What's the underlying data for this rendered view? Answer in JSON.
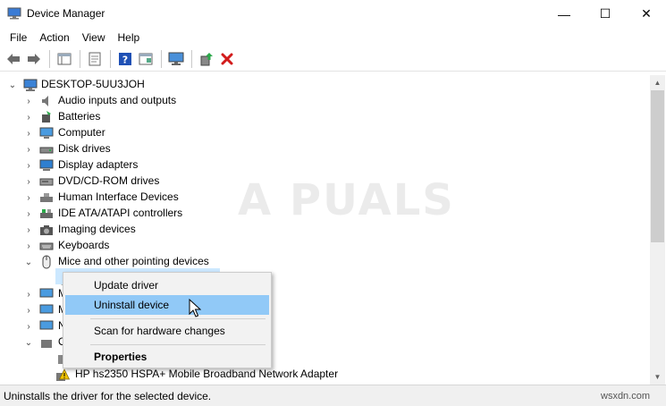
{
  "window": {
    "title": "Device Manager",
    "minimize": "—",
    "maximize": "☐",
    "close": "✕"
  },
  "menu": [
    "File",
    "Action",
    "View",
    "Help"
  ],
  "tree": {
    "root": "DESKTOP-5UU3JOH",
    "items": [
      {
        "label": "Audio inputs and outputs",
        "icon": "speaker-icon"
      },
      {
        "label": "Batteries",
        "icon": "battery-icon"
      },
      {
        "label": "Computer",
        "icon": "monitor-icon"
      },
      {
        "label": "Disk drives",
        "icon": "disk-icon"
      },
      {
        "label": "Display adapters",
        "icon": "display-icon"
      },
      {
        "label": "DVD/CD-ROM drives",
        "icon": "dvd-icon"
      },
      {
        "label": "Human Interface Devices",
        "icon": "hid-icon"
      },
      {
        "label": "IDE ATA/ATAPI controllers",
        "icon": "ide-icon"
      },
      {
        "label": "Imaging devices",
        "icon": "camera-icon"
      },
      {
        "label": "Keyboards",
        "icon": "keyboard-icon"
      },
      {
        "label": "Mice and other pointing devices",
        "icon": "mouse-icon"
      }
    ],
    "partial_items": [
      "M",
      "M",
      "N",
      "O"
    ],
    "last_item": "HP hs2350 HSPA+ Mobile Broadband Network Adapter"
  },
  "context_menu": {
    "items": [
      {
        "label": "Update driver"
      },
      {
        "label": "Uninstall device"
      },
      {
        "label": "Scan for hardware changes"
      },
      {
        "label": "Properties"
      }
    ]
  },
  "status": {
    "text": "Uninstalls the driver for the selected device.",
    "site": "wsxdn.com"
  },
  "watermark": "A PUALS",
  "colors": {
    "selection": "#cce8ff",
    "menu_highlight": "#91c9f7",
    "remove_red": "#d21b1b",
    "help_blue": "#1f50b5"
  }
}
